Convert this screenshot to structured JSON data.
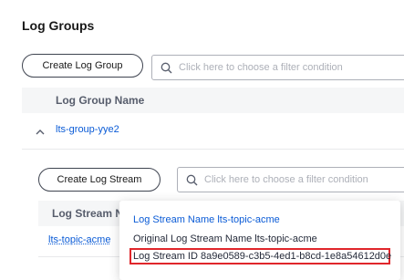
{
  "page": {
    "title": "Log Groups"
  },
  "group_toolbar": {
    "create_button": "Create Log Group",
    "filter_placeholder": "Click here to choose a filter condition"
  },
  "group_table": {
    "column_header": "Log Group Name",
    "rows": [
      {
        "name": "lts-group-yye2",
        "expanded": true
      }
    ]
  },
  "stream_toolbar": {
    "create_button": "Create Log Stream",
    "filter_placeholder": "Click here to choose a filter condition"
  },
  "stream_table": {
    "column_header_truncated": "Log Stream Na",
    "rows": [
      {
        "name": "lts-topic-acme"
      }
    ]
  },
  "popover": {
    "name_line": "Log Stream Name lts-topic-acme",
    "original_line": "Original Log Stream Name lts-topic-acme",
    "id_line": "Log Stream ID 8a9e0589-c3b5-4ed1-b8cd-1e8a54612d0e"
  },
  "colors": {
    "link": "#0a5bd6",
    "highlight": "#e0262b",
    "header_bg": "#f5f6f7"
  },
  "icons": {
    "filter": "search-icon",
    "expand": "chevron-up-icon"
  }
}
